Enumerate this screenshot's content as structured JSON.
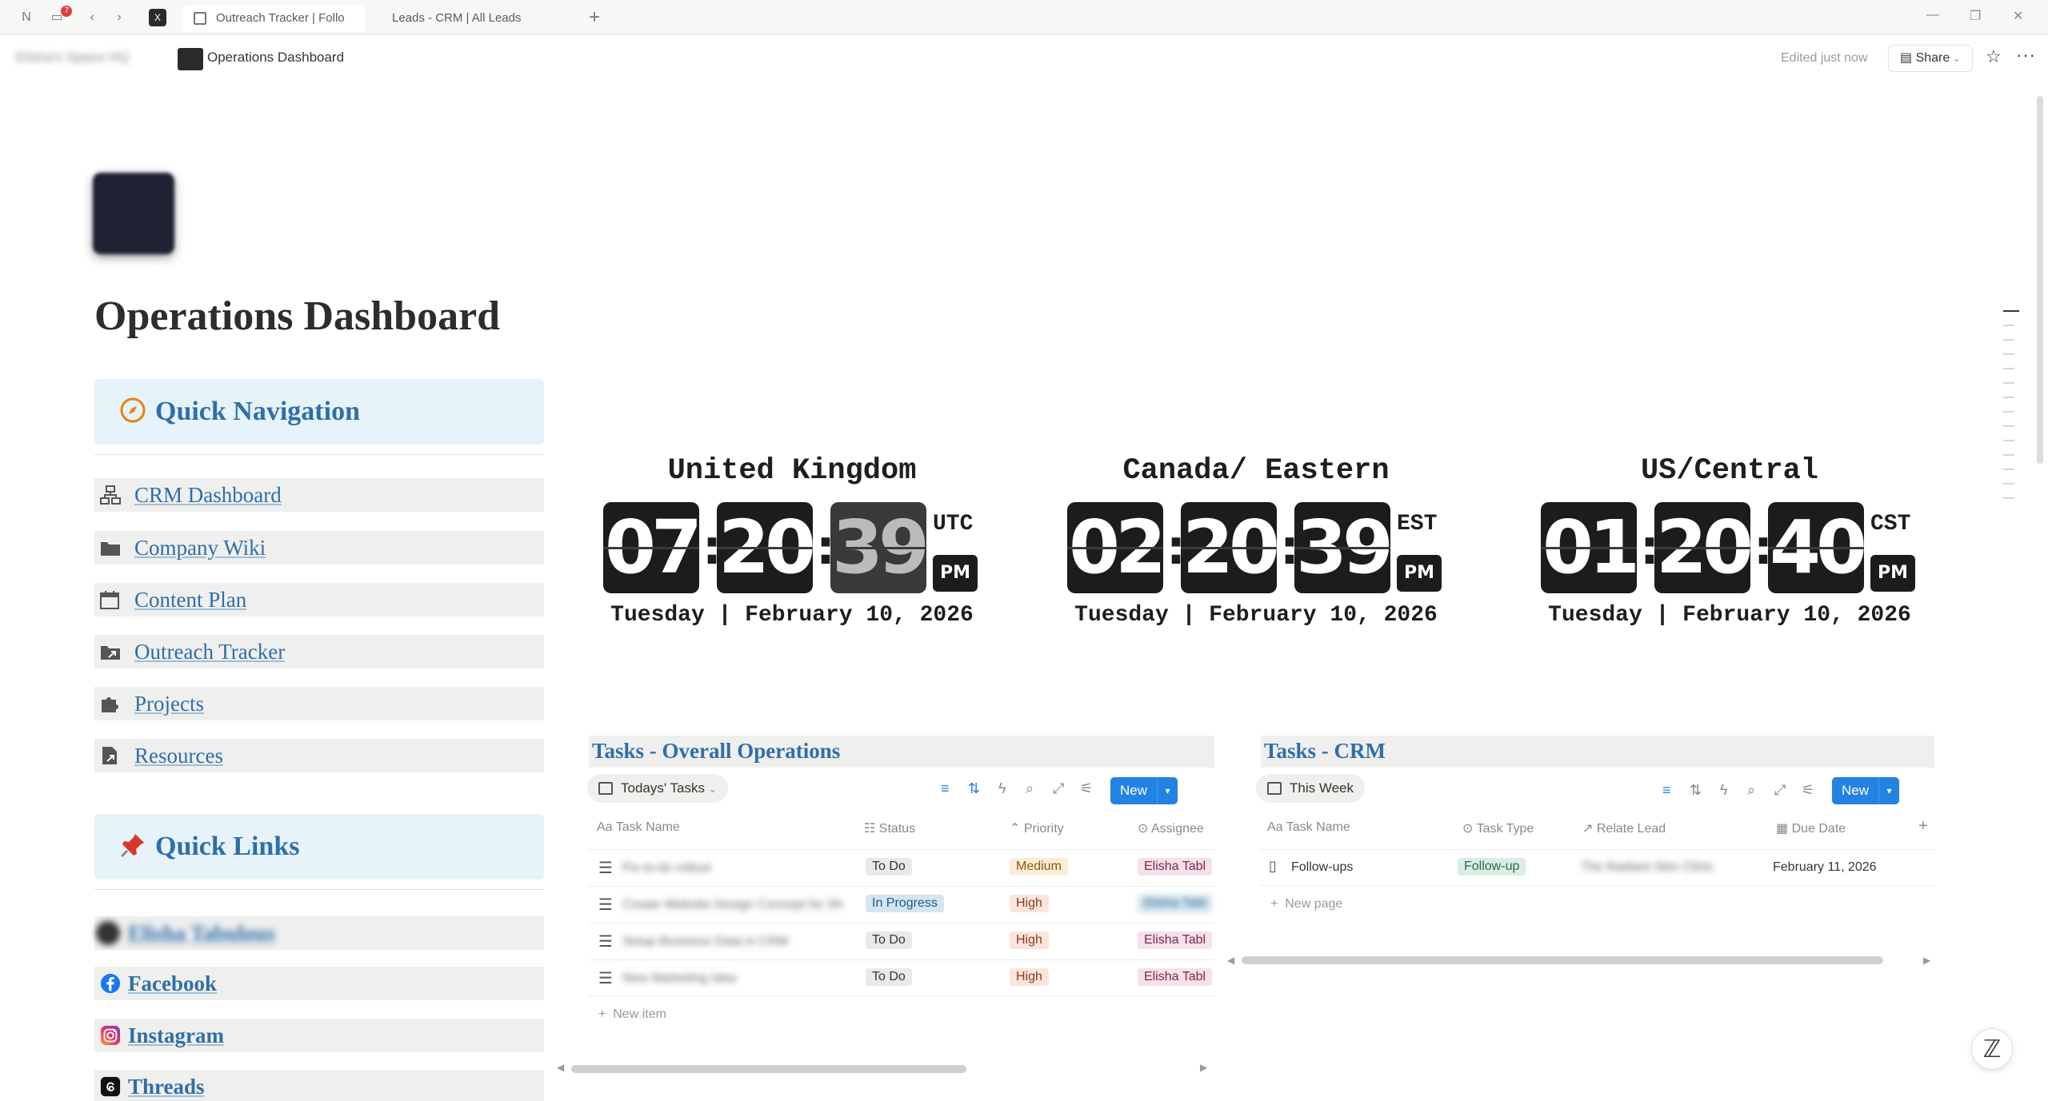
{
  "browser": {
    "badge_count": "7",
    "tabs": [
      {
        "label": "Outreach Tracker | Follo",
        "active": true
      },
      {
        "label": "Leads - CRM | All Leads",
        "active": false
      }
    ],
    "new_tab": "+",
    "window_controls": {
      "minimize": "—",
      "restore": "❐",
      "close": "✕"
    }
  },
  "topbar": {
    "workspace": "Elisha's Space HQ",
    "page_name": "Operations Dashboard",
    "edited": "Edited just now",
    "share": "Share",
    "favorite_icon": "☆",
    "more_icon": "···"
  },
  "page": {
    "title": "Operations Dashboard"
  },
  "quick_nav": {
    "title": "Quick Navigation",
    "icon": "🧭",
    "items": [
      {
        "label": "CRM Dashboard"
      },
      {
        "label": "Company Wiki"
      },
      {
        "label": "Content Plan"
      },
      {
        "label": "Outreach Tracker"
      },
      {
        "label": "Projects"
      },
      {
        "label": "Resources"
      }
    ]
  },
  "quick_links": {
    "title": "Quick Links",
    "icon": "📌",
    "items": [
      {
        "label": "Elisha Tabulous",
        "blurred": true
      },
      {
        "label": "Facebook"
      },
      {
        "label": "Instagram"
      },
      {
        "label": "Threads"
      }
    ]
  },
  "clocks": [
    {
      "region": "United Kingdom",
      "h": "07",
      "m": "20",
      "s": "39",
      "tz": "UTC",
      "ampm": "PM",
      "date": "Tuesday | February 10, 2026"
    },
    {
      "region": "Canada/ Eastern",
      "h": "02",
      "m": "20",
      "s": "39",
      "tz": "EST",
      "ampm": "PM",
      "date": "Tuesday | February 10, 2026"
    },
    {
      "region": "US/Central",
      "h": "01",
      "m": "20",
      "s": "40",
      "tz": "CST",
      "ampm": "PM",
      "date": "Tuesday | February 10, 2026"
    }
  ],
  "tasks_ops": {
    "title": "Tasks - Overall Operations",
    "view": "Todays' Tasks",
    "new_label": "New",
    "columns": [
      "Task Name",
      "Status",
      "Priority",
      "Assignee"
    ],
    "rows": [
      {
        "name": "Fix to-do rollout",
        "status": "To Do",
        "priority": "Medium",
        "assignee": "Elisha Tabl"
      },
      {
        "name": "Create Website Design Concept for Sh",
        "status": "In Progress",
        "priority": "High",
        "assignee": "Elisha Tabl"
      },
      {
        "name": "Setup Business Data in CRM",
        "status": "To Do",
        "priority": "High",
        "assignee": "Elisha Tabl"
      },
      {
        "name": "New Marketing Idea",
        "status": "To Do",
        "priority": "High",
        "assignee": "Elisha Tabl"
      }
    ],
    "new_item": "New item"
  },
  "tasks_crm": {
    "title": "Tasks - CRM",
    "view": "This Week",
    "new_label": "New",
    "columns": [
      "Task Name",
      "Task Type",
      "Relate Lead",
      "Due Date"
    ],
    "rows": [
      {
        "name": "Follow-ups",
        "type": "Follow-up",
        "lead": "The Radiant Skin Clinic",
        "due": "February 11, 2026"
      }
    ],
    "new_page": "New page"
  },
  "colors": {
    "accent_blue": "#2383e2",
    "link_blue": "#2f6fa8",
    "callout_bg": "#e7f3fa",
    "clock_dark": "#1c1c1c"
  }
}
